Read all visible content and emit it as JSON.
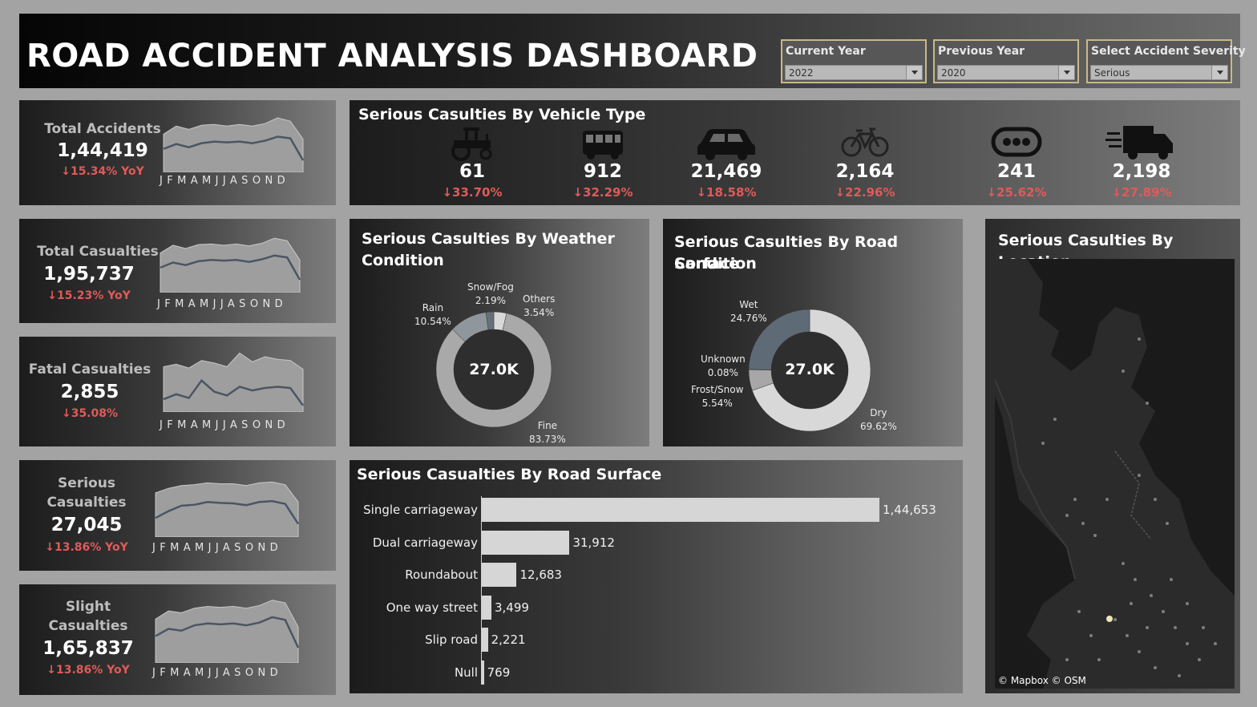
{
  "header": {
    "title": "ROAD ACCIDENT ANALYSIS DASHBOARD",
    "filters": [
      {
        "label": "Current Year",
        "value": "2022"
      },
      {
        "label": "Previous Year",
        "value": "2020"
      },
      {
        "label": "Select Accident Severity",
        "value": "Serious"
      }
    ]
  },
  "months_label": "JFMAMJJASOND",
  "kpis": [
    {
      "label": "Total Accidents",
      "value": "1,44,419",
      "yoy": "↓15.34% YoY"
    },
    {
      "label": "Total Casualties",
      "value": "1,95,737",
      "yoy": "↓15.23% YoY"
    },
    {
      "label": "Fatal Casualties",
      "value": "2,855",
      "yoy": "↓35.08%"
    },
    {
      "label_line1": "Serious",
      "label_line2": "Casualties",
      "value": "27,045",
      "yoy": "↓13.86% YoY"
    },
    {
      "label_line1": "Slight",
      "label_line2": "Casualties",
      "value": "1,65,837",
      "yoy": "↓13.86% YoY"
    }
  ],
  "sparklines": [
    {
      "current": [
        11.2,
        11.8,
        11.4,
        11.9,
        12.1,
        12.0,
        12.1,
        11.9,
        12.2,
        12.7,
        12.5,
        9.8
      ],
      "previous": [
        13.0,
        14.0,
        13.6,
        14.1,
        14.2,
        14.0,
        14.2,
        14.0,
        14.3,
        15.0,
        14.6,
        12.4
      ]
    },
    {
      "current": [
        15.2,
        16.0,
        15.6,
        16.2,
        16.4,
        16.3,
        16.4,
        16.1,
        16.5,
        17.1,
        16.8,
        13.3
      ],
      "previous": [
        17.5,
        18.7,
        18.2,
        18.8,
        18.9,
        18.7,
        18.9,
        18.6,
        19.0,
        19.8,
        19.4,
        16.4
      ]
    },
    {
      "current": [
        200,
        220,
        205,
        275,
        230,
        215,
        250,
        235,
        245,
        250,
        245,
        175
      ],
      "previous": [
        330,
        340,
        325,
        355,
        345,
        330,
        385,
        350,
        370,
        360,
        355,
        320
      ]
    },
    {
      "current": [
        2.05,
        2.2,
        2.32,
        2.34,
        2.4,
        2.38,
        2.37,
        2.33,
        2.4,
        2.42,
        2.36,
        1.92
      ],
      "previous": [
        2.6,
        2.7,
        2.76,
        2.78,
        2.82,
        2.8,
        2.8,
        2.76,
        2.82,
        2.84,
        2.78,
        2.4
      ]
    },
    {
      "current": [
        12.6,
        13.4,
        13.2,
        13.8,
        14.0,
        13.9,
        14.0,
        13.8,
        14.1,
        14.7,
        14.4,
        11.3
      ],
      "previous": [
        14.5,
        15.4,
        15.2,
        15.7,
        15.9,
        15.8,
        15.9,
        15.7,
        16.0,
        16.6,
        16.3,
        13.6
      ]
    }
  ],
  "vehicle": {
    "title": "Serious Casulties By Vehicle Type",
    "items": [
      {
        "icon": "tractor-icon",
        "value": "61",
        "yoy": "↓33.70%"
      },
      {
        "icon": "bus-icon",
        "value": "912",
        "yoy": "↓32.29%"
      },
      {
        "icon": "car-icon",
        "value": "21,469",
        "yoy": "↓18.58%"
      },
      {
        "icon": "bicycle-icon",
        "value": "2,164",
        "yoy": "↓22.96%"
      },
      {
        "icon": "other-vehicle-icon",
        "value": "241",
        "yoy": "↓25.62%"
      },
      {
        "icon": "van-icon",
        "value": "2,198",
        "yoy": "↓27.89%"
      }
    ]
  },
  "weather": {
    "title_line1": "Serious Casulties By Weather",
    "title_line2": "Condition",
    "center": "27.0K",
    "slices": [
      {
        "name": "Others",
        "pct": "3.54%",
        "value": 3.54,
        "color": "#d9d9d9"
      },
      {
        "name": "Fine",
        "pct": "83.73%",
        "value": 83.73,
        "color": "#a9a9a9"
      },
      {
        "name": "Rain",
        "pct": "10.54%",
        "value": 10.54,
        "color": "#8f969c"
      },
      {
        "name": "Snow/Fog",
        "pct": "2.19%",
        "value": 2.19,
        "color": "#667079"
      }
    ]
  },
  "road_condition": {
    "title_line1": "Serious Casulties By Road Sarface",
    "title_line2": "Condition",
    "center": "27.0K",
    "slices": [
      {
        "name": "Dry",
        "pct": "69.62%",
        "value": 69.62,
        "color": "#d8d8d8"
      },
      {
        "name": "Frost/Snow",
        "pct": "5.54%",
        "value": 5.54,
        "color": "#a7a7a7"
      },
      {
        "name": "Unknown",
        "pct": "0.08%",
        "value": 0.08,
        "color": "#9a9a9a"
      },
      {
        "name": "Wet",
        "pct": "24.76%",
        "value": 24.76,
        "color": "#5e6a75"
      }
    ]
  },
  "location": {
    "title": "Serious Casulties By Location",
    "attribution": "© Mapbox © OSM"
  },
  "road_surface": {
    "title": "Serious Casualties By Road Surface",
    "rows": [
      {
        "label": "Single carriageway",
        "value": 144653,
        "display": "1,44,653"
      },
      {
        "label": "Dual carriageway",
        "value": 31912,
        "display": "31,912"
      },
      {
        "label": "Roundabout",
        "value": 12683,
        "display": "12,683"
      },
      {
        "label": "One way street",
        "value": 3499,
        "display": "3,499"
      },
      {
        "label": "Slip road",
        "value": 2221,
        "display": "2,221"
      },
      {
        "label": "Null",
        "value": 769,
        "display": "769"
      }
    ]
  },
  "chart_data": [
    {
      "type": "bar",
      "title": "Serious Casualties By Road Surface",
      "categories": [
        "Single carriageway",
        "Dual carriageway",
        "Roundabout",
        "One way street",
        "Slip road",
        "Null"
      ],
      "values": [
        144653,
        31912,
        12683,
        3499,
        2221,
        769
      ]
    },
    {
      "type": "pie",
      "title": "Serious Casulties By Weather Condition",
      "categories": [
        "Fine",
        "Rain",
        "Snow/Fog",
        "Others"
      ],
      "values": [
        83.73,
        10.54,
        2.19,
        3.54
      ]
    },
    {
      "type": "pie",
      "title": "Serious Casulties By Road Sarface Condition",
      "categories": [
        "Dry",
        "Wet",
        "Unknown",
        "Frost/Snow"
      ],
      "values": [
        69.62,
        24.76,
        0.08,
        5.54
      ]
    }
  ]
}
